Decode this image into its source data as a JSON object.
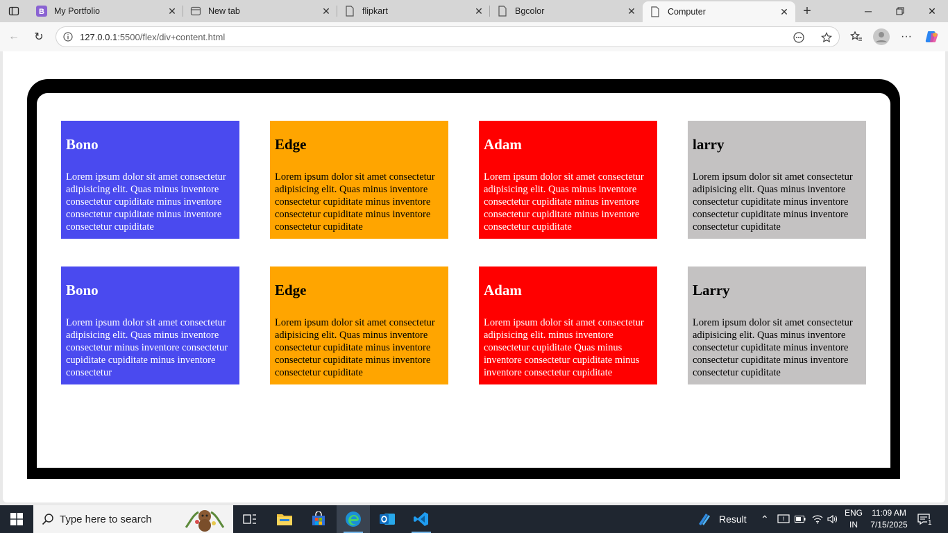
{
  "browser": {
    "tabs": [
      {
        "title": "My Portfolio",
        "icon": "bootstrap-icon"
      },
      {
        "title": "New tab",
        "icon": "new-tab-icon"
      },
      {
        "title": "flipkart",
        "icon": "page-icon"
      },
      {
        "title": "Bgcolor",
        "icon": "page-icon"
      },
      {
        "title": "Computer",
        "icon": "page-icon",
        "active": true
      }
    ],
    "url_host": "127.0.0.1",
    "url_rest": ":5500/flex/div+content.html"
  },
  "page": {
    "cards": [
      {
        "heading": "Bono",
        "body": "Lorem ipsum dolor sit amet consectetur adipisicing elit. Quas minus inventore consectetur cupiditate minus inventore consectetur cupiditate minus inventore consectetur cupiditate",
        "color": "#4a4aef"
      },
      {
        "heading": "Edge",
        "body": "Lorem ipsum dolor sit amet consectetur adipisicing elit. Quas minus inventore consectetur cupiditate minus inventore consectetur cupiditate minus inventore consectetur cupiditate",
        "color": "#ffa500"
      },
      {
        "heading": "Adam",
        "body": "Lorem ipsum dolor sit amet consectetur adipisicing elit. Quas minus inventore consectetur cupiditate minus inventore consectetur cupiditate minus inventore consectetur cupiditate",
        "color": "#ff0000"
      },
      {
        "heading": "larry",
        "body": "Lorem ipsum dolor sit amet consectetur adipisicing elit. Quas minus inventore consectetur cupiditate minus inventore consectetur cupiditate minus inventore consectetur cupiditate",
        "color": "#c4c2c2"
      },
      {
        "heading": "Bono",
        "body": "Lorem ipsum dolor sit amet consectetur adipisicing elit. Quas minus inventore consectetur minus inventore consectetur cupiditate cupiditate minus inventore consectetur",
        "color": "#4a4aef"
      },
      {
        "heading": "Edge",
        "body": "Lorem ipsum dolor sit amet consectetur adipisicing elit. Quas minus inventore consectetur cupiditate minus inventore consectetur cupiditate minus inventore consectetur cupiditate",
        "color": "#ffa500"
      },
      {
        "heading": "Adam",
        "body": "Lorem ipsum dolor sit amet consectetur adipisicing elit. minus inventore consectetur cupiditate Quas minus inventore consectetur cupiditate minus inventore consectetur cupiditate",
        "color": "#ff0000"
      },
      {
        "heading": "Larry",
        "body": "Lorem ipsum dolor sit amet consectetur adipisicing elit. Quas minus inventore consectetur cupiditate minus inventore consectetur cupiditate minus inventore consectetur cupiditate",
        "color": "#c4c2c2"
      }
    ]
  },
  "taskbar": {
    "search_placeholder": "Type here to search",
    "weather_label": "Result",
    "lang_line1": "ENG",
    "lang_line2": "IN",
    "time": "11:09 AM",
    "date": "7/15/2025",
    "notification_count": "1"
  }
}
